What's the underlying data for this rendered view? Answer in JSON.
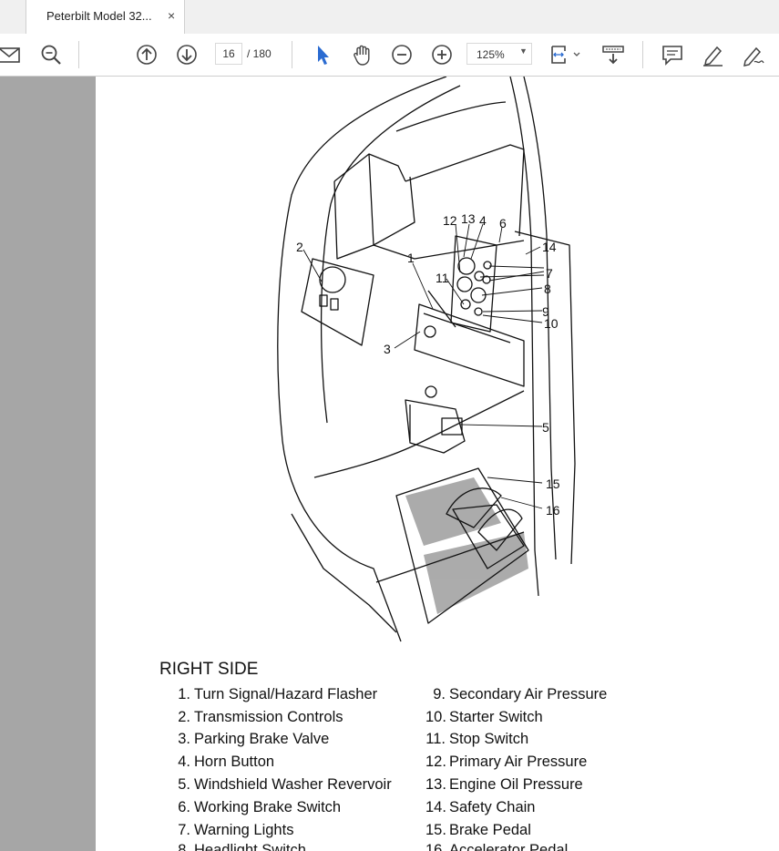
{
  "tab": {
    "title": "Peterbilt Model 32...",
    "close": "×"
  },
  "toolbar": {
    "page_current": "16",
    "page_total": "/ 180",
    "zoom": "125%",
    "icons": [
      "mail-icon",
      "zoom-out-icon",
      "prev-page-icon",
      "next-page-icon",
      "select-cursor-icon",
      "hand-icon",
      "zoom-minus-icon",
      "zoom-plus-icon",
      "fit-page-icon",
      "scroll-mode-icon",
      "comment-icon",
      "highlight-icon",
      "sign-icon"
    ]
  },
  "figure": {
    "callouts": [
      "1",
      "2",
      "3",
      "4",
      "5",
      "6",
      "7",
      "8",
      "9",
      "10",
      "11",
      "12",
      "13",
      "14",
      "15",
      "16"
    ]
  },
  "legend": {
    "title": "RIGHT SIDE",
    "left": [
      {
        "n": "1.",
        "t": "Turn Signal/Hazard Flasher"
      },
      {
        "n": "2.",
        "t": "Transmission Controls"
      },
      {
        "n": "3.",
        "t": "Parking Brake Valve"
      },
      {
        "n": "4.",
        "t": "Horn Button"
      },
      {
        "n": "5.",
        "t": "Windshield Washer Revervoir"
      },
      {
        "n": "6.",
        "t": "Working Brake Switch"
      },
      {
        "n": "7.",
        "t": "Warning Lights"
      },
      {
        "n": "8.",
        "t": "Headlight Switch"
      }
    ],
    "right": [
      {
        "n": "9.",
        "t": "Secondary Air Pressure"
      },
      {
        "n": "10.",
        "t": "Starter Switch"
      },
      {
        "n": "11.",
        "t": "Stop Switch"
      },
      {
        "n": "12.",
        "t": "Primary Air Pressure"
      },
      {
        "n": "13.",
        "t": "Engine Oil Pressure"
      },
      {
        "n": "14.",
        "t": "Safety Chain"
      },
      {
        "n": "15.",
        "t": "Brake Pedal"
      },
      {
        "n": "16.",
        "t": "Accelerator Pedal"
      }
    ]
  }
}
